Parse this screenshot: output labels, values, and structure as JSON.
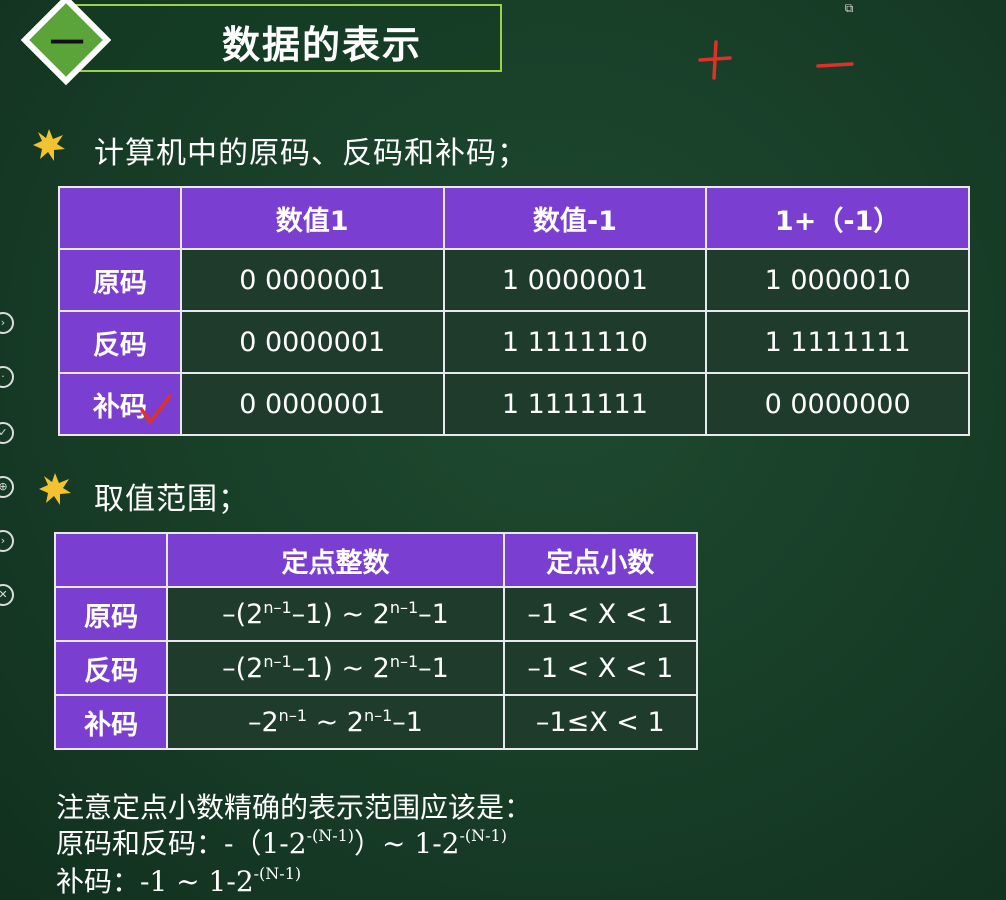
{
  "header": {
    "section_number": "一",
    "title": "数据的表示",
    "annotation_plus": "+",
    "annotation_minus": "−"
  },
  "section1": {
    "heading": "计算机中的原码、反码和补码；",
    "table": {
      "headers": [
        "",
        "数值1",
        "数值-1",
        "1+（-1）"
      ],
      "rows": [
        {
          "label": "原码",
          "cells": [
            "0 0000001",
            "1 0000001",
            "1 0000010"
          ]
        },
        {
          "label": "反码",
          "cells": [
            "0 0000001",
            "1 1111110",
            "1 1111111"
          ]
        },
        {
          "label": "补码",
          "cells": [
            "0 0000001",
            "1 1111111",
            "0 0000000"
          ]
        }
      ]
    }
  },
  "section2": {
    "heading": "取值范围；",
    "table": {
      "headers": [
        "",
        "定点整数",
        "定点小数"
      ],
      "rows": [
        {
          "label": "原码",
          "int_pre": "–(2",
          "int_sup1": "n–1",
          "int_mid": "–1) ~ 2",
          "int_sup2": "n–1",
          "int_post": "–1",
          "frac": "–1 < X < 1"
        },
        {
          "label": "反码",
          "int_pre": "–(2",
          "int_sup1": "n–1",
          "int_mid": "–1) ~ 2",
          "int_sup2": "n–1",
          "int_post": "–1",
          "frac": "–1 < X < 1"
        },
        {
          "label": "补码",
          "int_pre": "–2",
          "int_sup1": "n–1",
          "int_mid": " ~ 2",
          "int_sup2": "n–1",
          "int_post": "–1",
          "frac": "–1≤X < 1"
        }
      ]
    }
  },
  "notes": {
    "line1": "注意定点小数精确的表示范围应该是：",
    "line2_a": "原码和反码：-（1-2",
    "line2_sup1": "-(N-1)",
    "line2_b": "）~ 1-2",
    "line2_sup2": "-(N-1)",
    "line3_a": "补码：-1 ~ 1-2",
    "line3_sup": "-(N-1)"
  },
  "colors": {
    "board": "#163a26",
    "table_header": "#7a3fd0",
    "title_border": "#9bd24a",
    "annotation": "#e0302a",
    "star": "#f2c230"
  }
}
